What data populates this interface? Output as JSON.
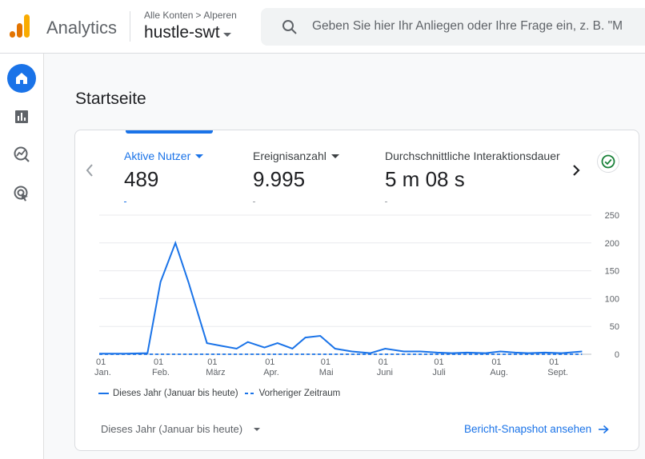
{
  "header": {
    "app_title": "Analytics",
    "breadcrumb_account": "Alle Konten",
    "breadcrumb_separator": ">",
    "breadcrumb_property": "Alperen",
    "property_name": "hustle-swt",
    "search_placeholder": "Geben Sie hier Ihr Anliegen oder Ihre Frage ein, z. B. \"M"
  },
  "sidebar": {
    "items": [
      {
        "icon": "home-icon",
        "active": true
      },
      {
        "icon": "reports-icon",
        "active": false
      },
      {
        "icon": "explore-icon",
        "active": false
      },
      {
        "icon": "advertising-icon",
        "active": false
      }
    ]
  },
  "page_title": "Startseite",
  "metrics": [
    {
      "label": "Aktive Nutzer",
      "value": "489",
      "active": true
    },
    {
      "label": "Ereignisanzahl",
      "value": "9.995",
      "active": false
    },
    {
      "label": "Durchschnittliche Interaktionsdauer",
      "value": "5 m 08 s",
      "active": false
    }
  ],
  "chart_data": {
    "type": "line",
    "y_ticks": [
      "250",
      "200",
      "150",
      "100",
      "50",
      "0"
    ],
    "ylim": [
      0,
      250
    ],
    "x_ticks": [
      {
        "day": "01",
        "month": "Jan."
      },
      {
        "day": "01",
        "month": "Feb."
      },
      {
        "day": "01",
        "month": "März"
      },
      {
        "day": "01",
        "month": "Apr."
      },
      {
        "day": "01",
        "month": "Mai"
      },
      {
        "day": "01",
        "month": "Juni"
      },
      {
        "day": "01",
        "month": "Juli"
      },
      {
        "day": "01",
        "month": "Aug."
      },
      {
        "day": "01",
        "month": "Sept."
      }
    ],
    "series": [
      {
        "name": "Dieses Jahr (Januar bis heute)",
        "style": "solid",
        "color": "#1a73e8",
        "x": [
          "2024-01-01",
          "2024-01-15",
          "2024-01-27",
          "2024-02-03",
          "2024-02-11",
          "2024-02-18",
          "2024-02-28",
          "2024-03-07",
          "2024-03-15",
          "2024-03-21",
          "2024-03-30",
          "2024-04-06",
          "2024-04-14",
          "2024-04-21",
          "2024-04-29",
          "2024-05-07",
          "2024-05-16",
          "2024-05-26",
          "2024-06-03",
          "2024-06-13",
          "2024-06-22",
          "2024-07-01",
          "2024-07-09",
          "2024-07-17",
          "2024-07-27",
          "2024-08-04",
          "2024-08-12",
          "2024-08-19",
          "2024-08-28",
          "2024-09-06",
          "2024-09-17"
        ],
        "values": [
          1,
          1,
          2,
          130,
          200,
          130,
          20,
          15,
          10,
          22,
          12,
          20,
          10,
          30,
          33,
          10,
          5,
          2,
          10,
          5,
          5,
          3,
          2,
          3,
          2,
          5,
          3,
          2,
          3,
          2,
          5
        ]
      },
      {
        "name": "Vorheriger Zeitraum",
        "style": "dashed",
        "color": "#1a73e8",
        "x": [
          "2024-01-01",
          "2024-09-17"
        ],
        "values": [
          0,
          0
        ]
      }
    ]
  },
  "legend": {
    "current": "Dieses Jahr (Januar bis heute)",
    "previous": "Vorheriger Zeitraum"
  },
  "footer": {
    "date_range": "Dieses Jahr (Januar bis heute)",
    "snapshot_link": "Bericht-Snapshot ansehen"
  }
}
